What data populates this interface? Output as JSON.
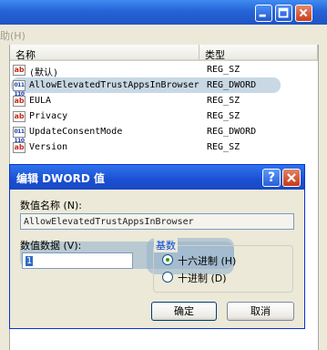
{
  "window": {
    "menu_partial": "助(H)"
  },
  "list": {
    "headers": {
      "name": "名称",
      "type": "类型"
    },
    "rows": [
      {
        "icon": "string-value-icon",
        "name": "(默认)",
        "type": "REG_SZ"
      },
      {
        "icon": "dword-value-icon",
        "name": "AllowElevatedTrustAppsInBrowser",
        "type": "REG_DWORD"
      },
      {
        "icon": "string-value-icon",
        "name": "EULA",
        "type": "REG_SZ"
      },
      {
        "icon": "string-value-icon",
        "name": "Privacy",
        "type": "REG_SZ"
      },
      {
        "icon": "dword-value-icon",
        "name": "UpdateConsentMode",
        "type": "REG_DWORD"
      },
      {
        "icon": "string-value-icon",
        "name": "Version",
        "type": "REG_SZ"
      }
    ]
  },
  "dialog": {
    "title": "编辑 DWORD 值",
    "help_glyph": "?",
    "value_name_label": "数值名称 (N):",
    "value_name": "AllowElevatedTrustAppsInBrowser",
    "value_data_label": "数值数据 (V):",
    "value_data": "1",
    "base_label": "基数",
    "radio_hex": "十六进制 (H)",
    "radio_dec": "十进制 (D)",
    "base_selected": "hex",
    "ok_label": "确定",
    "cancel_label": "取消"
  },
  "colors": {
    "titlebar": "#2563d8",
    "dialog_bg": "#ece9d8",
    "highlight": "#9ab8cd",
    "group_legend": "#0046d5"
  }
}
